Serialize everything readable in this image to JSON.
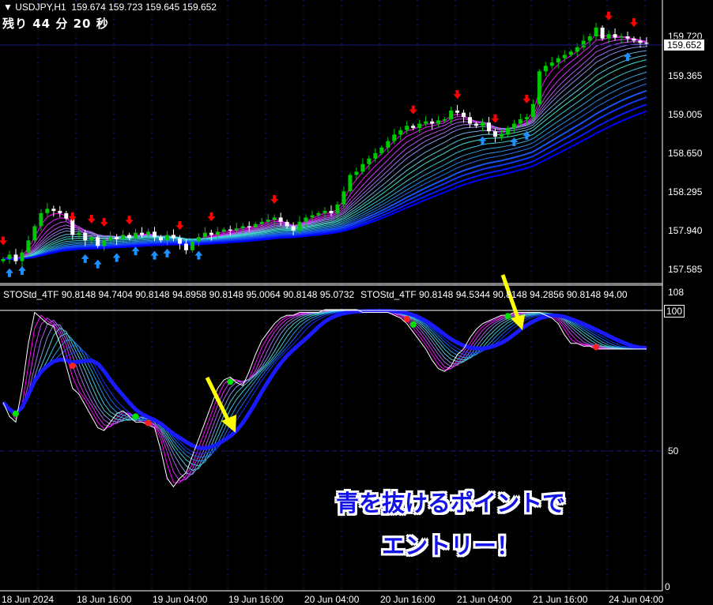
{
  "header": {
    "symbol": "USDJPY,H1",
    "open": "159.674",
    "high": "159.723",
    "low": "159.645",
    "close": "159.652"
  },
  "timer": {
    "label_remaining": "残り",
    "minutes": "44",
    "minutes_unit": "分",
    "seconds": "20",
    "seconds_unit": "秒"
  },
  "indicator_header": [
    "STOStd_4TF 90.8148 94.7404 90.8148 94.8958 90.8148 95.0064 90.8148 95.0732",
    "STOStd_4TF 90.8148 94.5344 90.8148 94.2856 90.8148 94.00"
  ],
  "annotation": {
    "line1": "青を抜けるポイントで",
    "line2": "エントリー！"
  },
  "colors": {
    "bull": "#00c800",
    "bear": "#ffffff",
    "ribbon_fast": "#ff00ff",
    "ribbon_mid": "#40e0d0",
    "ribbon_slow": "#0000ff",
    "sell_arrow": "#ff0000",
    "buy_arrow": "#1e90ff",
    "pointer": "#ffff00"
  },
  "chart_data": [
    {
      "type": "candlestick",
      "title": "USDJPY,H1",
      "current_price": "159.652",
      "y_ticks": [
        "159.720",
        "159.365",
        "159.005",
        "158.650",
        "158.295",
        "157.940",
        "157.585"
      ],
      "ylim": [
        157.53,
        159.99
      ],
      "x_ticks": [
        "18 Jun 2024",
        "18 Jun 16:00",
        "19 Jun 04:00",
        "19 Jun 16:00",
        "20 Jun 04:00",
        "20 Jun 16:00",
        "21 Jun 04:00",
        "21 Jun 16:00",
        "24 Jun 04:00"
      ],
      "closes": [
        157.68,
        157.72,
        157.66,
        157.74,
        157.85,
        157.98,
        158.1,
        158.14,
        158.12,
        158.1,
        158.05,
        157.9,
        157.92,
        157.85,
        157.88,
        157.8,
        157.85,
        157.88,
        157.86,
        157.9,
        157.87,
        157.92,
        157.9,
        157.93,
        157.88,
        157.85,
        157.9,
        157.87,
        157.82,
        157.76,
        157.84,
        157.88,
        157.92,
        157.9,
        157.93,
        157.95,
        157.94,
        157.96,
        157.98,
        157.97,
        158.0,
        158.02,
        158.04,
        158.06,
        158.02,
        157.98,
        157.94,
        158.02,
        158.06,
        158.08,
        158.1,
        158.12,
        158.1,
        158.18,
        158.3,
        158.45,
        158.48,
        158.55,
        158.6,
        158.65,
        158.7,
        158.76,
        158.82,
        158.86,
        158.9,
        158.88,
        158.92,
        158.94,
        158.92,
        158.95,
        158.96,
        159.04,
        159.02,
        158.98,
        158.92,
        158.9,
        158.93,
        158.85,
        158.8,
        158.82,
        158.88,
        158.92,
        158.96,
        158.98,
        159.1,
        159.4,
        159.45,
        159.48,
        159.52,
        159.55,
        159.58,
        159.62,
        159.68,
        159.72,
        159.8,
        159.7,
        159.74,
        159.71,
        159.72,
        159.7,
        159.68,
        159.66,
        159.652
      ],
      "sell_signals": [
        0,
        11,
        14,
        16,
        20,
        28,
        33,
        43,
        65,
        72,
        78,
        83,
        96,
        100
      ],
      "buy_signals": [
        1,
        3,
        13,
        15,
        18,
        21,
        24,
        26,
        31,
        76,
        81,
        83,
        99
      ]
    },
    {
      "type": "line",
      "title": "STOStd_4TF",
      "y_ticks": [
        "108",
        "100",
        "50",
        "0"
      ],
      "ylim": [
        0,
        108
      ],
      "level": 50,
      "stoch": [
        67,
        62,
        60,
        72,
        88,
        99,
        97,
        95,
        94,
        88,
        80,
        72,
        70,
        66,
        62,
        58,
        57,
        60,
        63,
        64,
        62,
        60,
        60,
        59,
        58,
        50,
        40,
        37,
        40,
        42,
        48,
        54,
        60,
        66,
        72,
        75,
        76,
        74,
        73,
        78,
        84,
        89,
        92,
        95,
        97,
        98,
        98,
        99,
        99,
        99,
        99,
        100,
        100,
        100,
        100,
        100,
        100,
        99,
        99,
        99,
        99,
        99,
        98,
        97,
        95,
        92,
        89,
        86,
        82,
        79,
        78,
        80,
        84,
        86,
        90,
        93,
        95,
        96,
        97,
        98,
        98,
        99,
        99,
        99,
        99,
        99,
        98,
        97,
        95,
        91,
        88,
        88,
        87,
        87,
        86,
        86,
        86,
        86,
        86,
        86,
        86,
        86,
        86
      ],
      "red_dots": [
        11,
        23,
        64,
        94
      ],
      "green_dots": [
        2,
        21,
        36,
        65,
        80
      ]
    }
  ]
}
